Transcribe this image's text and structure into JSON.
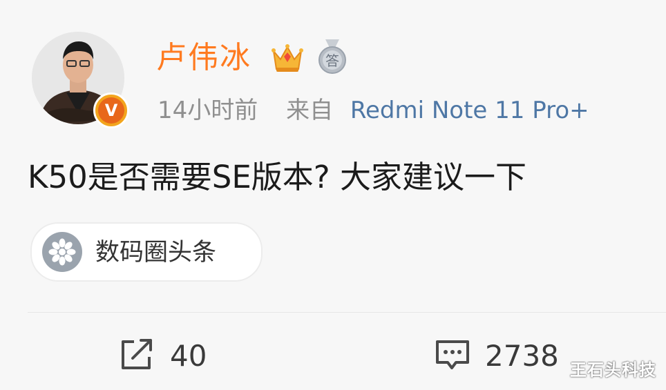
{
  "post": {
    "author": {
      "name": "卢伟冰",
      "verified_badge": "V"
    },
    "meta": {
      "time": "14小时前",
      "from_label": "来自",
      "device": "Redmi Note 11 Pro+"
    },
    "content": "K50是否需要SE版本? 大家建议一下",
    "topic": {
      "label": "数码圈头条",
      "icon": "flower-icon"
    },
    "actions": {
      "repost_count": "40",
      "comment_count": "2738"
    }
  },
  "badges": {
    "crown_icon": "crown-icon",
    "medal_label": "答"
  },
  "watermark": "王石头科技",
  "colors": {
    "username": "#ff7a1f",
    "device_link": "#4e77a5",
    "meta": "#8f8f8f",
    "verified": "#f3a51d"
  }
}
